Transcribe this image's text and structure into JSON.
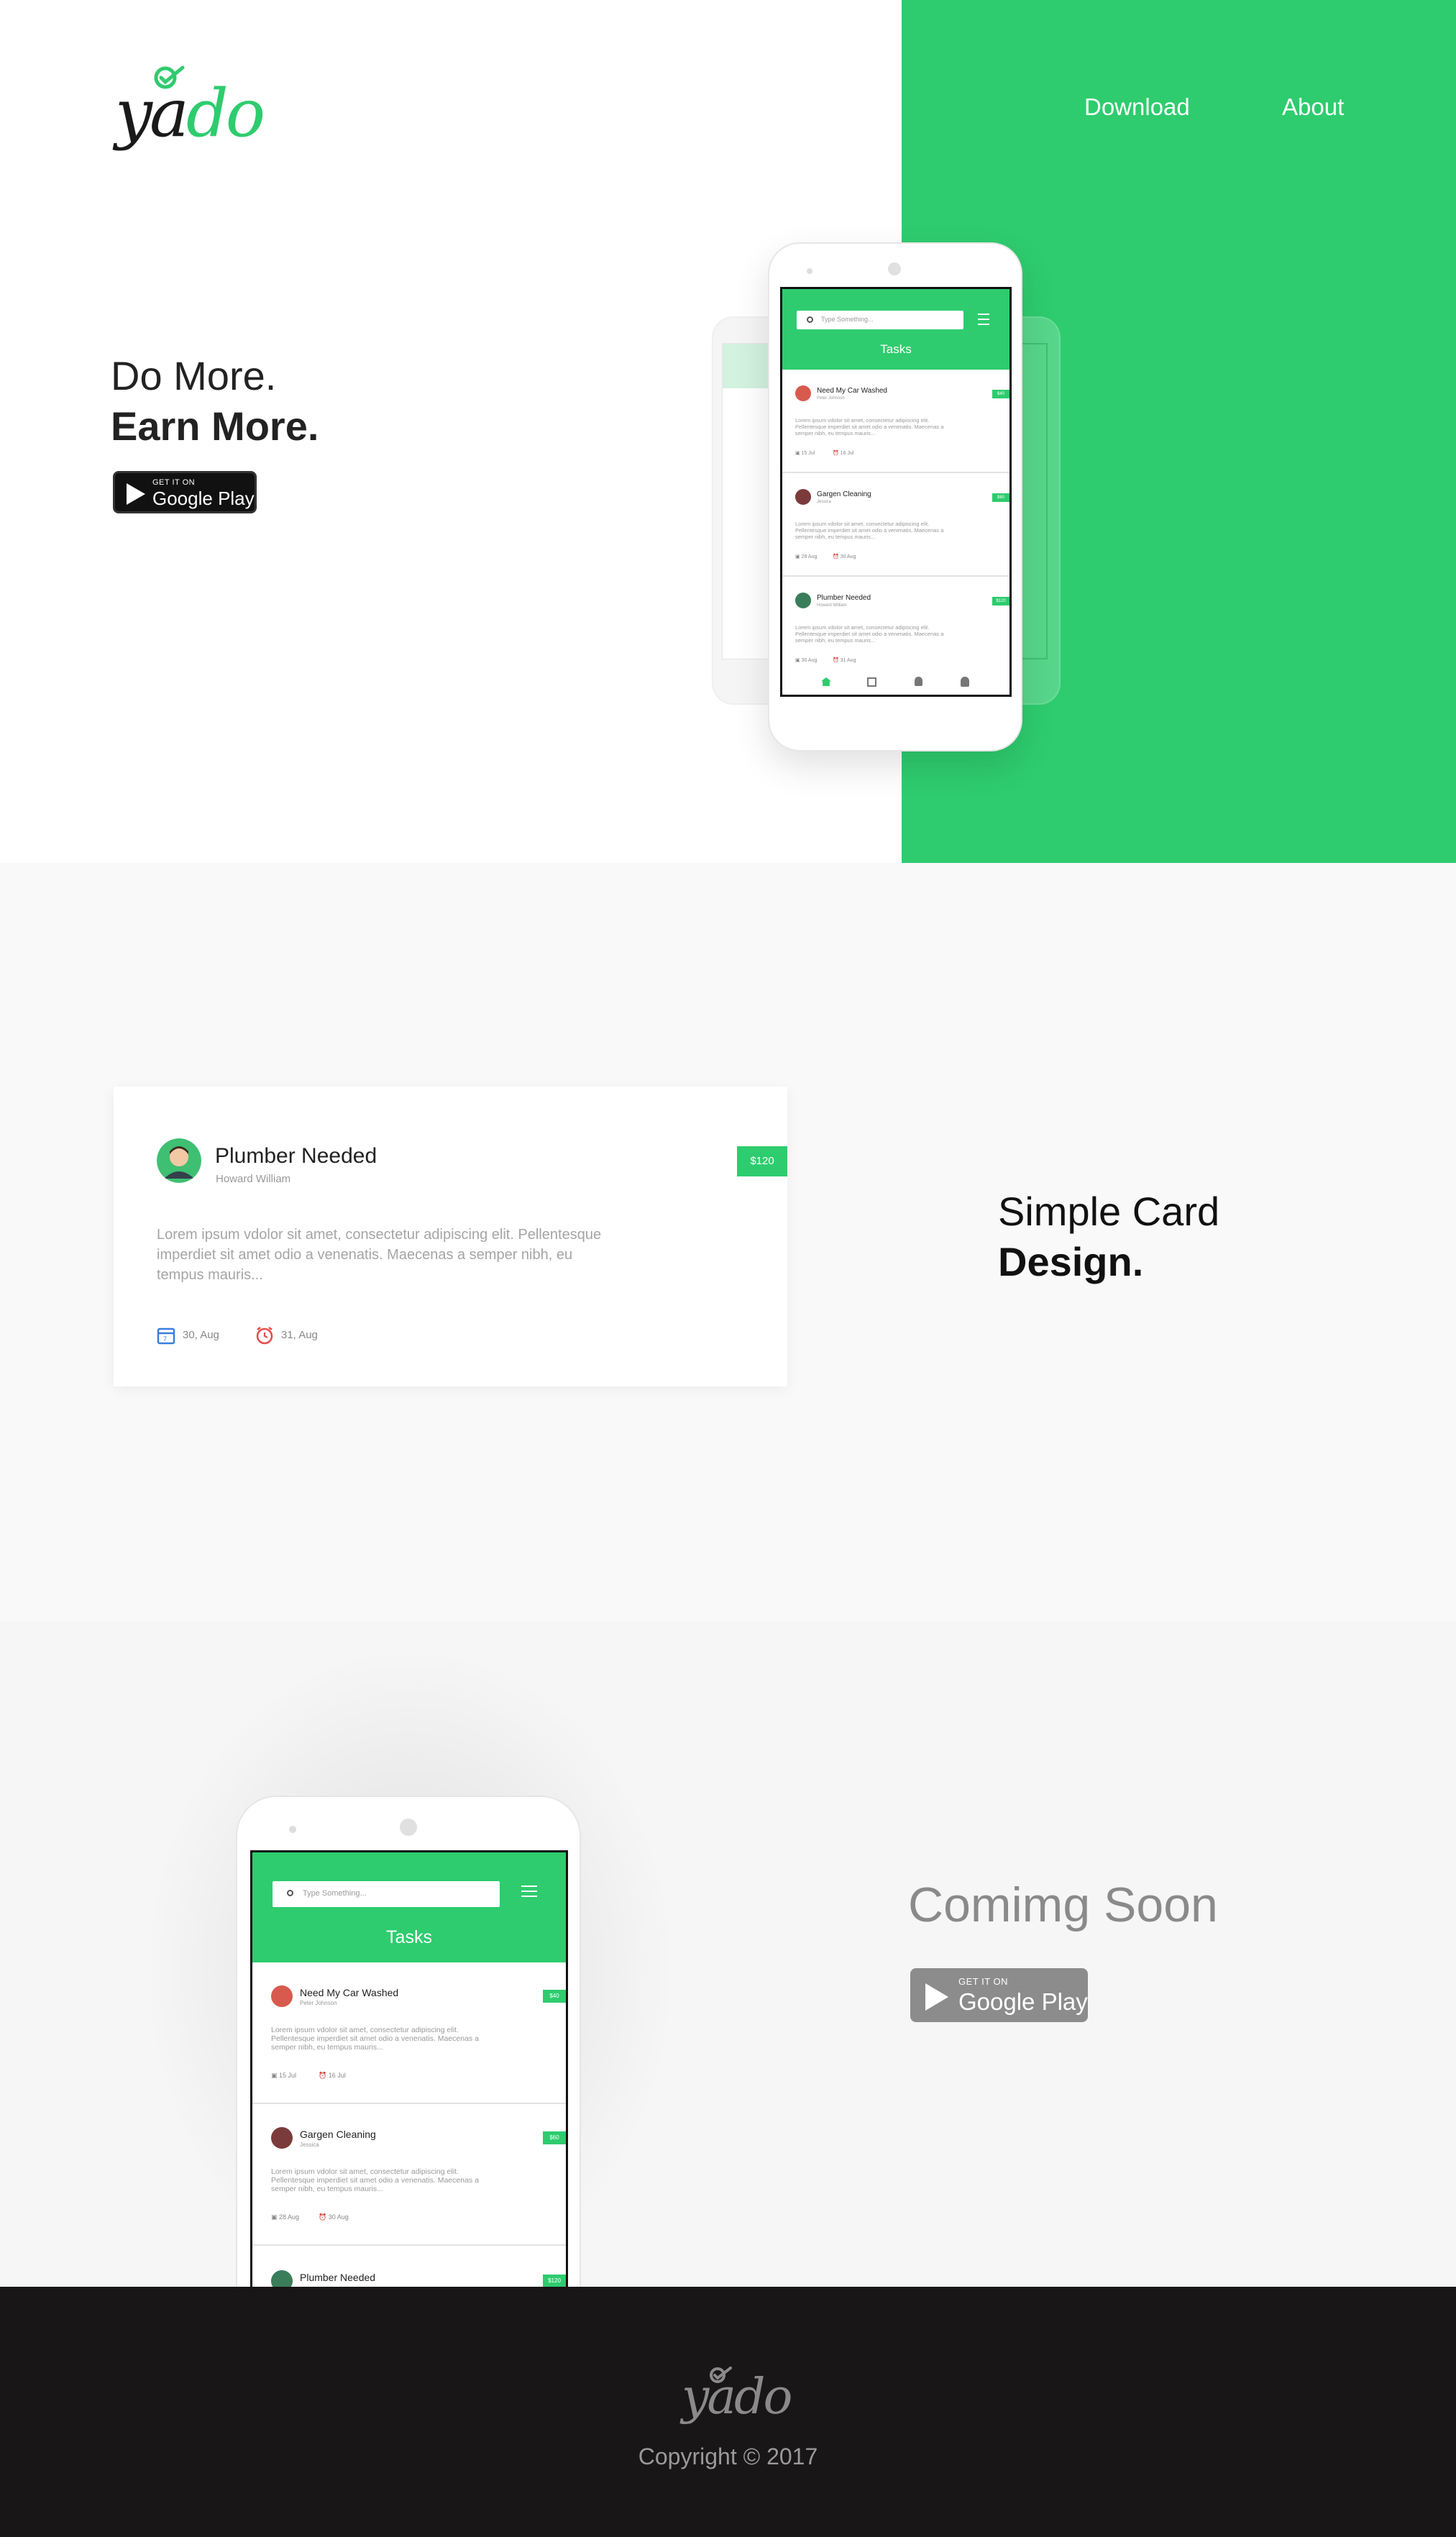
{
  "brand": {
    "logo_prefix": "ya",
    "logo_suffix": "do",
    "footer_logo": "yado",
    "accent": "#2ecc6e"
  },
  "nav": {
    "download": "Download",
    "about": "About"
  },
  "hero": {
    "line1": "Do More.",
    "line2": "Earn More."
  },
  "store_badge": {
    "small": "GET IT ON",
    "big": "Google Play"
  },
  "app": {
    "search_placeholder": "Type Something...",
    "title": "Tasks",
    "tasks": [
      {
        "name": "Need My Car Washed",
        "sub": "Peter Johnson",
        "price": "$40",
        "lorem": "Lorem ipsum vdolor sit amet, consectetur adipiscing elit. Pellentesque imperdiet sit amet odio a venenatis. Maecenas a semper nibh, eu tempus mauris...",
        "date1": "15 Jul",
        "date2": "16 Jul"
      },
      {
        "name": "Gargen Cleaning",
        "sub": "Jessica",
        "price": "$60",
        "lorem": "Lorem ipsum vdolor sit amet, consectetur adipiscing elit. Pellentesque imperdiet sit amet odio a venenatis. Maecenas a semper nibh, eu tempus mauris...",
        "date1": "28 Aug",
        "date2": "30 Aug"
      },
      {
        "name": "Plumber Needed",
        "sub": "Howard William",
        "price": "$120",
        "lorem": "Lorem ipsum vdolor sit amet, consectetur adipiscing elit. Pellentesque imperdiet sit amet odio a venenatis. Maecenas a semper nibh, eu tempus mauris...",
        "date1": "30 Aug",
        "date2": "31 Aug"
      }
    ]
  },
  "card": {
    "name": "Plumber Needed",
    "sub": "Howard William",
    "price": "$120",
    "lorem": "Lorem ipsum vdolor sit amet, consectetur adipiscing elit. Pellentesque imperdiet sit amet odio a venenatis. Maecenas a semper nibh, eu tempus mauris...",
    "date1": "30, Aug",
    "date2": "31, Aug"
  },
  "section2": {
    "line1": "Simple Card",
    "line2": "Design."
  },
  "section3": {
    "title": "Comimg Soon"
  },
  "footer": {
    "copyright": "Copyright © 2017"
  },
  "icons": {
    "calendar": "calendar-icon",
    "alarm": "alarm-clock-icon",
    "search": "search-icon",
    "menu": "hamburger-menu-icon",
    "play": "play-store-icon",
    "check": "check-icon",
    "home": "home-icon",
    "bell": "bell-icon",
    "user": "user-icon"
  }
}
